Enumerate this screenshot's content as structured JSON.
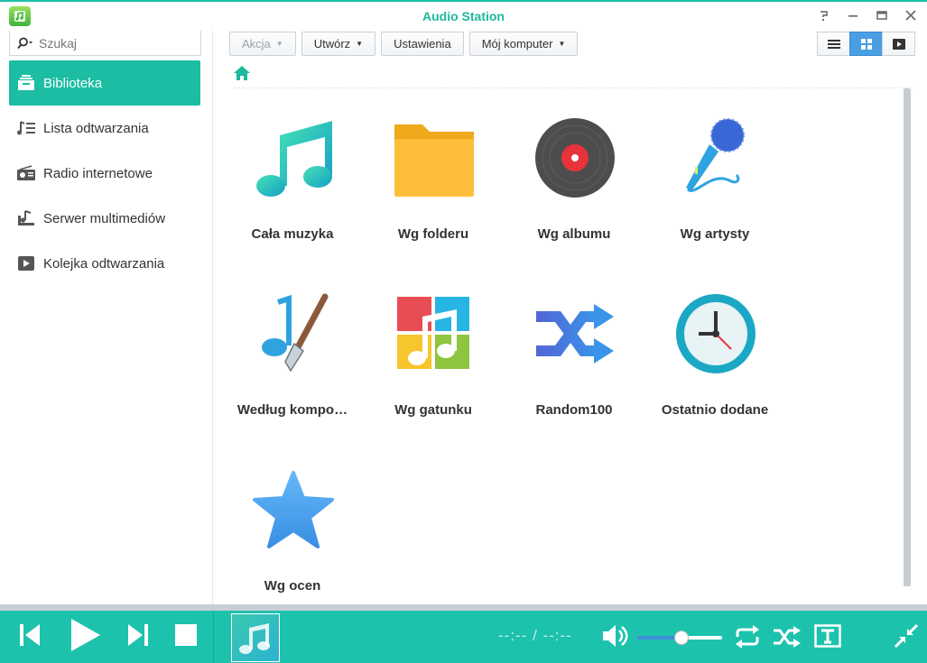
{
  "window": {
    "title": "Audio Station"
  },
  "sidebar": {
    "search_placeholder": "Szukaj",
    "items": [
      {
        "label": "Biblioteka",
        "icon": "library-icon",
        "active": true
      },
      {
        "label": "Lista odtwarzania",
        "icon": "playlist-icon",
        "active": false
      },
      {
        "label": "Radio internetowe",
        "icon": "radio-icon",
        "active": false
      },
      {
        "label": "Serwer multimediów",
        "icon": "media-server-icon",
        "active": false
      },
      {
        "label": "Kolejka odtwarzania",
        "icon": "play-queue-icon",
        "active": false
      }
    ]
  },
  "toolbar": {
    "action_label": "Akcja",
    "create_label": "Utwórz",
    "settings_label": "Ustawienia",
    "computer_label": "Mój komputer"
  },
  "view_modes": {
    "active": "grid",
    "modes": [
      "list-view-icon",
      "grid-view-icon",
      "play-view-icon"
    ]
  },
  "library": {
    "tiles": [
      {
        "label": "Cała muzyka",
        "icon": "music-note-icon"
      },
      {
        "label": "Wg folderu",
        "icon": "folder-icon"
      },
      {
        "label": "Wg albumu",
        "icon": "vinyl-record-icon"
      },
      {
        "label": "Wg artysty",
        "icon": "microphone-icon"
      },
      {
        "label": "Według kompo…",
        "icon": "composer-brush-icon"
      },
      {
        "label": "Wg gatunku",
        "icon": "genre-tiles-icon"
      },
      {
        "label": "Random100",
        "icon": "shuffle-icon"
      },
      {
        "label": "Ostatnio dodane",
        "icon": "clock-icon"
      },
      {
        "label": "Wg ocen",
        "icon": "star-icon"
      }
    ]
  },
  "player": {
    "time": "--:-- / --:--",
    "volume": 0.53,
    "colors": {
      "bar": "#1dc2ad",
      "accent": "#1cbda2"
    }
  }
}
